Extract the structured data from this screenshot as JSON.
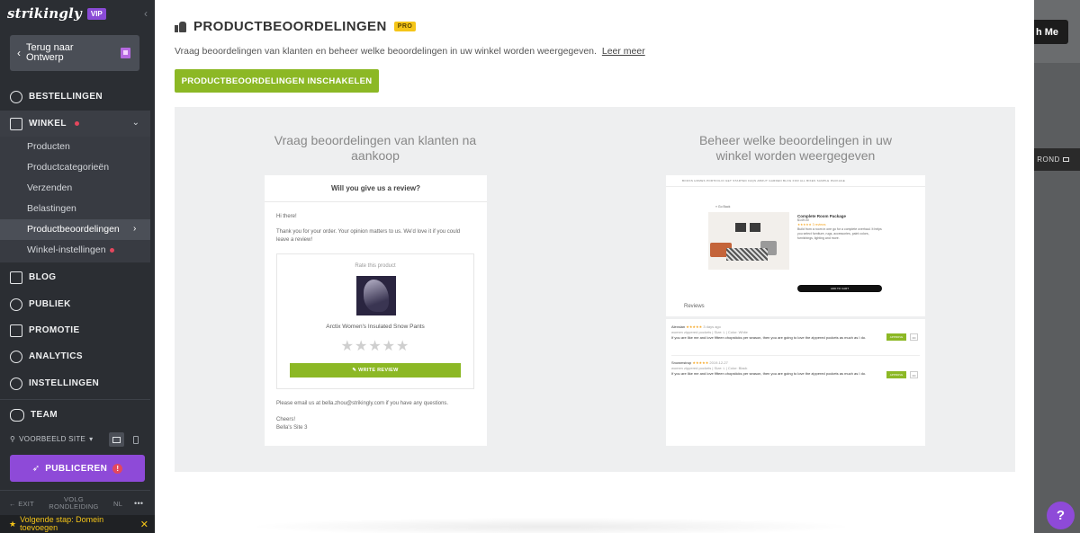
{
  "sidebar": {
    "brand": "strikingly",
    "vip_badge": "VIP",
    "back_button": "Terug naar Ontwerp",
    "nav": [
      {
        "label": "BESTELLINGEN",
        "icon": "dollar-icon"
      },
      {
        "label": "WINKEL",
        "icon": "store-icon"
      },
      {
        "label": "BLOG",
        "icon": "pen-icon"
      },
      {
        "label": "PUBLIEK",
        "icon": "people-icon"
      },
      {
        "label": "PROMOTIE",
        "icon": "megaphone-icon"
      },
      {
        "label": "ANALYTICS",
        "icon": "gauge-icon"
      },
      {
        "label": "INSTELLINGEN",
        "icon": "gear-icon"
      },
      {
        "label": "TEAM",
        "icon": "team-icon"
      }
    ],
    "winkel_sub": [
      "Producten",
      "Productcategorieën",
      "Verzenden",
      "Belastingen",
      "Productbeoordelingen",
      "Winkel-instellingen"
    ],
    "preview_label": "VOORBEELD SITE",
    "publish": "PUBLICEREN",
    "publish_warning": "!",
    "footer": {
      "exit": "EXIT",
      "tour": "VOLG RONDLEIDING",
      "lang": "NL",
      "more": "•••"
    },
    "next_step": "Volgende stap: Domein toevoegen"
  },
  "background": {
    "top_button": "h Me",
    "rond_button": "ROND"
  },
  "modal": {
    "title": "PRODUCTBEOORDELINGEN",
    "pro_badge": "PRO",
    "description": "Vraag beoordelingen van klanten en beheer welke beoordelingen in uw winkel worden weergegeven.",
    "learn_more": "Leer meer",
    "enable_button": "PRODUCTBEOORDELINGEN INSCHAKELEN",
    "left_heading": "Vraag beoordelingen van klanten na aankoop",
    "right_heading": "Beheer welke beoordelingen in uw winkel worden weergegeven",
    "email": {
      "header": "Will you give us a review?",
      "greeting": "Hi there!",
      "body": "Thank you for your order. Your opinion matters to us. We'd love it if you could leave a review!",
      "rate_label": "Rate this product",
      "product_name": "Arctix Women's Insulated Snow Pants",
      "stars": "★★★★★",
      "write_review": "✎  WRITE REVIEW",
      "contact": "Please email us at bella.zhou@strikingly.com if you have any questions.",
      "signoff": "Cheers!",
      "signature": "Bella's Site 3"
    },
    "shop_preview": {
      "nav": "BOOKS  HOMES     PORTFOLIO     GET STARTED     FAQS     ABOUT GARDEN     BLOG     FOR ALL BIKES     SAMPLE PACKAGE",
      "back": "« Go Back",
      "product_title": "Complete Room Package",
      "price": "$149.00",
      "rating": "★★★★★  3 reviews",
      "details": "Build from a room in one go for a complete overhaul. It helps you select furniture, rugs, accessories, paint colors, furnishings, lighting and more.",
      "add_to_cart": "ADD TO CART",
      "reviews_heading": "Reviews"
    },
    "review_rows": [
      {
        "author": "Alexsian",
        "stars": "★★★★★",
        "date": "3 days ago",
        "meta": "women zippered pockets  |  Size: L  |  Color: White",
        "text": "If you are like me and love fifteen chopsticks per season, then you are going to love the zippered pockets as much as I do.",
        "approve": "APPROVE",
        "more": "•••"
      },
      {
        "author": "Snowmstrup",
        "stars": "★★★★★",
        "date": "2019-12-27",
        "meta": "women zippered pockets  |  Size: L  |  Color: Black",
        "text": "If you are like me and love fifteen chopsticks per season, then you are going to love the zippered pockets as much as I do.",
        "approve": "APPROVE",
        "more": "•••"
      }
    ]
  },
  "help_button": "?",
  "colors": {
    "sidebar_bg": "#2b2e33",
    "accent_purple": "#8e4ad8",
    "accent_green": "#8cb825",
    "pro_yellow": "#f5c518",
    "alert_red": "#e4475d"
  }
}
